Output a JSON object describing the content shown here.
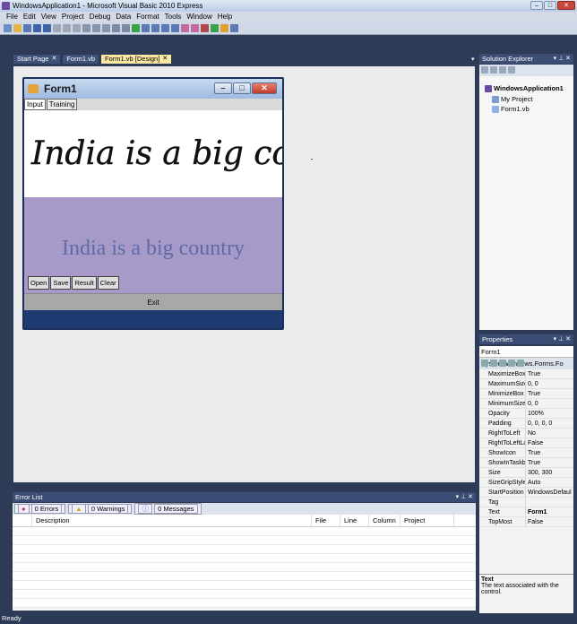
{
  "window": {
    "title": "WindowsApplication1 - Microsoft Visual Basic 2010 Express"
  },
  "menu": [
    "File",
    "Edit",
    "View",
    "Project",
    "Debug",
    "Data",
    "Format",
    "Tools",
    "Window",
    "Help"
  ],
  "tabs": [
    {
      "label": "Start Page"
    },
    {
      "label": "Form1.vb"
    },
    {
      "label": "Form1.vb [Design]"
    }
  ],
  "form": {
    "title": "Form1",
    "inner_tabs": [
      "Input",
      "Training"
    ],
    "handwriting": "India is a big country",
    "recognized": "India is a big country",
    "buttons": [
      "Open",
      "Save",
      "Result",
      "Clear"
    ],
    "exit_label": "Exit"
  },
  "solution_explorer": {
    "title": "Solution Explorer",
    "items": [
      "WindowsApplication1",
      "My Project",
      "Form1.vb"
    ]
  },
  "properties": {
    "title": "Properties",
    "object": "Form1 System.Windows.Forms.Fo",
    "rows": [
      {
        "name": "MaximizeBox",
        "value": "True"
      },
      {
        "name": "MaximumSize",
        "value": "0, 0"
      },
      {
        "name": "MinimizeBox",
        "value": "True"
      },
      {
        "name": "MinimumSize",
        "value": "0, 0"
      },
      {
        "name": "Opacity",
        "value": "100%"
      },
      {
        "name": "Padding",
        "value": "0, 0, 0, 0"
      },
      {
        "name": "RightToLeft",
        "value": "No"
      },
      {
        "name": "RightToLeftLa",
        "value": "False"
      },
      {
        "name": "ShowIcon",
        "value": "True"
      },
      {
        "name": "ShowInTaskb",
        "value": "True"
      },
      {
        "name": "Size",
        "value": "300, 300"
      },
      {
        "name": "SizeGripStyle",
        "value": "Auto"
      },
      {
        "name": "StartPosition",
        "value": "WindowsDefaul"
      },
      {
        "name": "Tag",
        "value": ""
      },
      {
        "name": "Text",
        "value": "Form1"
      },
      {
        "name": "TopMost",
        "value": "False"
      }
    ],
    "desc_title": "Text",
    "desc_text": "The text associated with the control."
  },
  "error_list": {
    "title": "Error List",
    "filters": [
      "0 Errors",
      "0 Warnings",
      "0 Messages"
    ],
    "columns": [
      "Description",
      "File",
      "Line",
      "Column",
      "Project"
    ]
  },
  "status": "Ready"
}
